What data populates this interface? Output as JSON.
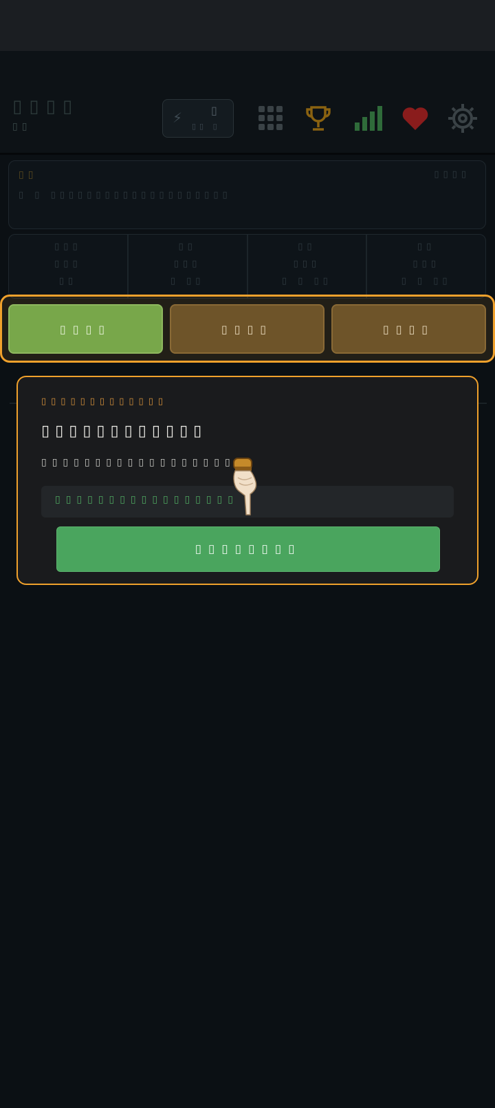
{
  "status_bar": {},
  "capsule": {
    "more_icon": "more-dots-icon",
    "record_icon": "record-circle-icon"
  },
  "header": {
    "brand": "▯▯▯▯",
    "brand_sub": "▯▯",
    "energy": {
      "icon": "lightning-bolt-icon",
      "value": "▯",
      "label": "▯▯ ▯"
    },
    "icons": [
      "grid-menu-icon",
      "trophy-icon",
      "bar-chart-icon",
      "heart-icon",
      "gear-icon"
    ],
    "colors": {
      "trophy": "#8a6210",
      "chart": "#2f6b3a",
      "heart": "#8a1c1c",
      "gear": "#3a4246"
    }
  },
  "info_card": {
    "label": "▯▯",
    "right": "▯▯▯▯",
    "text": "▯ ▯ ▯▯▯▯▯▯▯▯▯▯▯▯▯▯▯▯▯▯▯▯"
  },
  "stats": [
    {
      "l1": "▯▯▯",
      "l2": "▯▯▯",
      "l3": "▯▯"
    },
    {
      "l1": "▯▯",
      "l2": "▯▯▯",
      "l3": "▯ ▯▯"
    },
    {
      "l1": "▯▯",
      "l2": "▯▯▯",
      "l3": "▯ ▯ ▯▯"
    },
    {
      "l1": "▯▯",
      "l2": "▯▯▯",
      "l3": "▯ ▯ ▯▯"
    }
  ],
  "tabs": [
    {
      "label": "▯▯▯▯",
      "active": true
    },
    {
      "label": "▯▯▯▯",
      "active": false
    },
    {
      "label": "▯▯▯▯",
      "active": false
    }
  ],
  "dialog": {
    "step": "▯▯▯▯▯▯▯▯▯▯▯▯▯",
    "title": "▯▯▯▯▯▯▯▯▯▯▯▯",
    "description": "▯▯▯▯▯▯▯▯▯▯▯▯▯▯▯▯▯▯▯▯",
    "hint": "▯▯▯▯▯▯▯▯▯▯▯▯▯▯▯▯▯",
    "button": "▯▯▯▯▯▯▯▯",
    "accent": "#f0a12c"
  },
  "pointer_icon": "pointing-hand-icon"
}
